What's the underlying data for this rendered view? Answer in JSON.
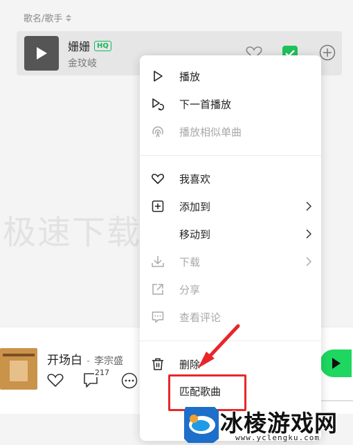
{
  "list": {
    "column_header": "歌名/歌手",
    "song": {
      "title": "姗姗",
      "quality_badge": "HQ",
      "artist": "金玟岐"
    }
  },
  "background_watermark": "极速下载",
  "context_menu": {
    "items": [
      {
        "label": "播放",
        "icon": "play-outline-icon",
        "disabled": false
      },
      {
        "label": "下一首播放",
        "icon": "play-next-icon",
        "disabled": false
      },
      {
        "label": "播放相似单曲",
        "icon": "radio-icon",
        "disabled": true
      },
      {
        "label": "我喜欢",
        "icon": "heart-icon",
        "disabled": false
      },
      {
        "label": "添加到",
        "icon": "add-square-icon",
        "disabled": false,
        "submenu": true
      },
      {
        "label": "移动到",
        "icon": "",
        "disabled": false,
        "submenu": true
      },
      {
        "label": "下载",
        "icon": "download-icon",
        "disabled": true,
        "submenu": true
      },
      {
        "label": "分享",
        "icon": "share-icon",
        "disabled": true
      },
      {
        "label": "查看评论",
        "icon": "comment-icon",
        "disabled": true
      },
      {
        "label": "删除",
        "icon": "trash-icon",
        "disabled": false
      },
      {
        "label": "匹配歌曲",
        "icon": "",
        "disabled": false
      }
    ]
  },
  "player": {
    "title": "开场白",
    "separator": "-",
    "artist": "李宗盛",
    "comment_count": "217"
  },
  "watermark_logo": {
    "text": "冰棱游戏网",
    "url": "www.yclengku.com"
  },
  "colors": {
    "accent_green": "#1ed760",
    "annotation_red": "#e8262a",
    "disabled_gray": "#a8a8a8"
  }
}
